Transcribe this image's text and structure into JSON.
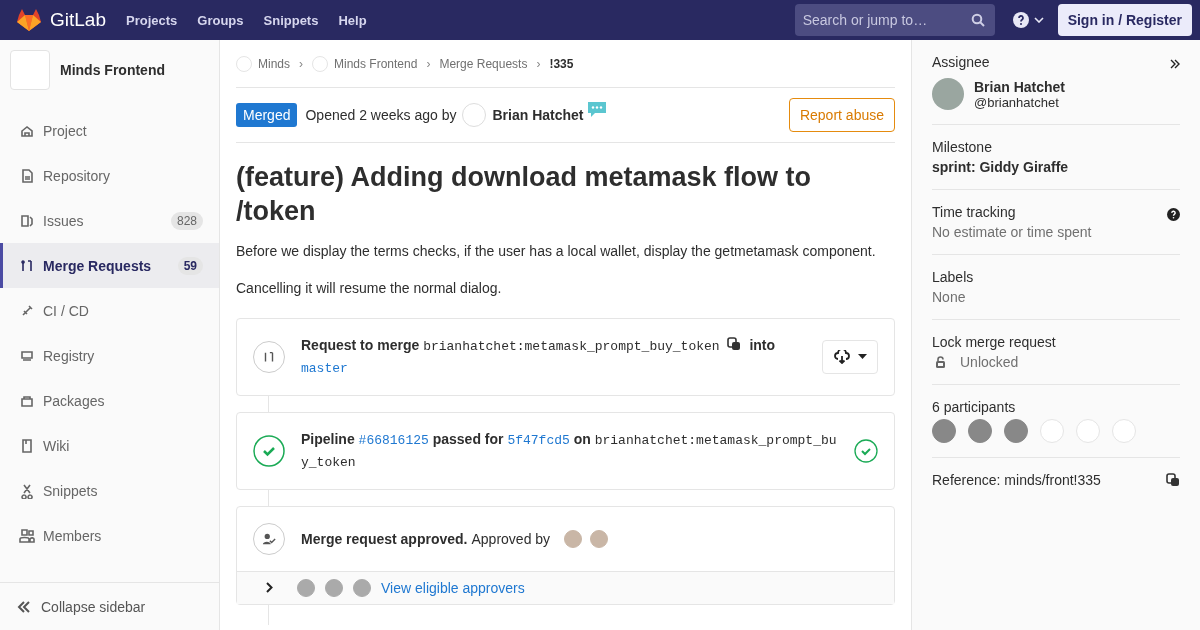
{
  "navbar": {
    "brand": "GitLab",
    "links": [
      "Projects",
      "Groups",
      "Snippets",
      "Help"
    ],
    "search": {
      "placeholder": "Search or jump to…"
    },
    "sign_in": "Sign in / Register"
  },
  "sidebar": {
    "project": "Minds Frontend",
    "items": [
      {
        "label": "Project",
        "selected": false
      },
      {
        "label": "Repository",
        "selected": false
      },
      {
        "label": "Issues",
        "count": "828",
        "selected": false
      },
      {
        "label": "Merge Requests",
        "count": "59",
        "selected": true
      },
      {
        "label": "CI / CD",
        "selected": false
      },
      {
        "label": "Registry",
        "selected": false
      },
      {
        "label": "Packages",
        "selected": false
      },
      {
        "label": "Wiki",
        "selected": false
      },
      {
        "label": "Snippets",
        "selected": false
      },
      {
        "label": "Members",
        "selected": false
      }
    ],
    "collapse": "Collapse sidebar"
  },
  "breadcrumbs": [
    {
      "label": "Minds",
      "avatar": true
    },
    {
      "separator": "›",
      "label": "Minds Frontend",
      "avatar": true
    },
    {
      "separator": "›",
      "label": "Merge Requests",
      "avatar": false
    },
    {
      "separator": "›",
      "label": "!335",
      "avatar": false
    }
  ],
  "header": {
    "status": "Merged",
    "opened": "Opened 2 weeks ago by",
    "author": "Brian Hatchet",
    "report": "Report abuse"
  },
  "title": "(feature) Adding download metamask flow to /token",
  "description": [
    "Before we display the terms checks, if the user has a local wallet, display the getmetamask component.",
    "Cancelling it will resume the normal dialog."
  ],
  "merge_widget": {
    "label": "Request to merge",
    "source": "brianhatchet:metamask_prompt_buy_token",
    "into": "into",
    "target": "master"
  },
  "pipeline": {
    "label": "Pipeline",
    "id": "#66816125",
    "passed_for": "passed for",
    "commit": "5f47fcd5",
    "on": "on",
    "branch": "brianhatchet:metamask_prompt_buy_token"
  },
  "approval": {
    "title": "Merge request approved.",
    "approved_by": "Approved by",
    "approvers": [
      {
        "photo": true
      },
      {
        "photo": true
      }
    ],
    "eligible": [
      {
        "photo": true
      },
      {
        "photo": true
      },
      {
        "photo": true
      }
    ],
    "link": "View eligible approvers"
  },
  "right_sidebar": {
    "assignee": {
      "label": "Assignee",
      "name": "Brian Hatchet",
      "username": "@brianhatchet"
    },
    "milestone": {
      "label": "Milestone",
      "value": "sprint: Giddy Giraffe"
    },
    "time_tracking": {
      "label": "Time tracking",
      "value": "No estimate or time spent"
    },
    "labels": {
      "label": "Labels",
      "value": "None"
    },
    "lock": {
      "label": "Lock merge request",
      "value": "Unlocked"
    },
    "participants": {
      "label": "6 participants",
      "items": [
        {
          "photo": true
        },
        {
          "photo": true
        },
        {
          "photo": true
        },
        {
          "photo": false
        },
        {
          "photo": false
        },
        {
          "photo": false
        }
      ]
    },
    "reference": "Reference: minds/front!335"
  }
}
